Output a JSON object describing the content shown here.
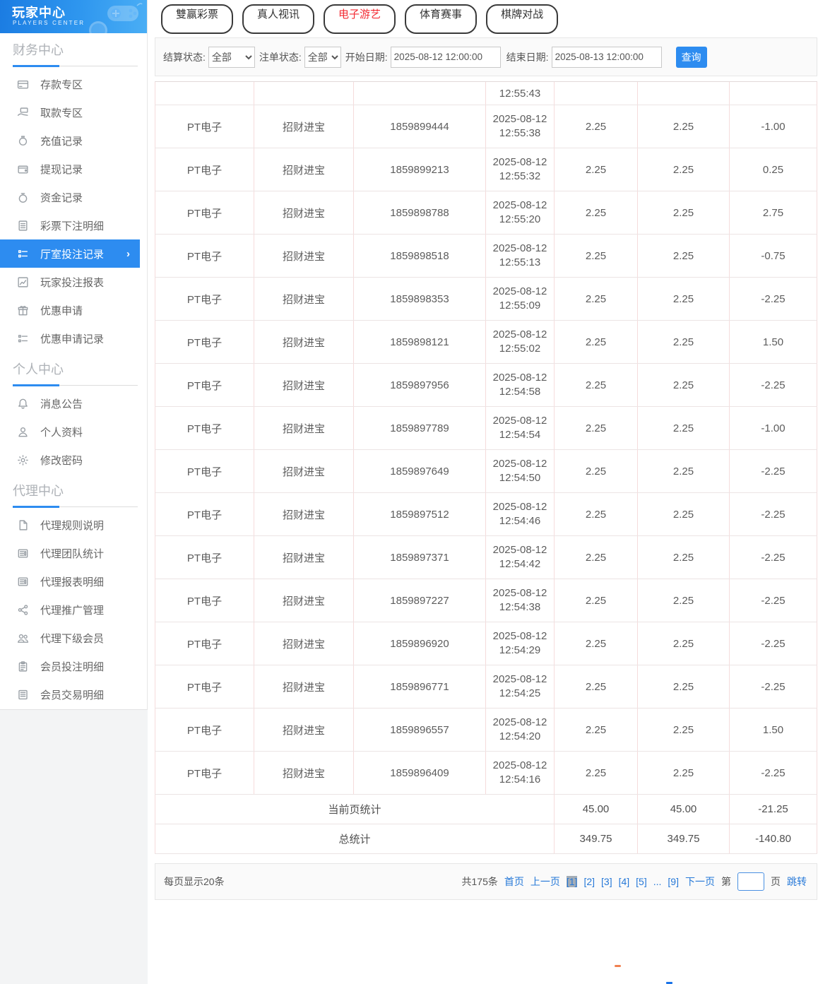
{
  "brand": {
    "title": "玩家中心",
    "subtitle": "PLAYERS CENTER"
  },
  "colors": {
    "accent_blue": "#2d8cf0",
    "link_blue": "#2779d8",
    "active_red": "#f32b33",
    "table_border_pink": "#f5dcdc",
    "current_page_bg": "#a4adb6"
  },
  "sidebar": {
    "sections": [
      {
        "title": "财务中心",
        "items": [
          {
            "label": "存款专区",
            "icon": "card"
          },
          {
            "label": "取款专区",
            "icon": "hand"
          },
          {
            "label": "充值记录",
            "icon": "moneybag"
          },
          {
            "label": "提现记录",
            "icon": "wallet"
          },
          {
            "label": "资金记录",
            "icon": "coins"
          },
          {
            "label": "彩票下注明细",
            "icon": "doc"
          },
          {
            "label": "厅室投注记录",
            "icon": "list",
            "active": true,
            "chevron": "›"
          },
          {
            "label": "玩家投注报表",
            "icon": "chart"
          },
          {
            "label": "优惠申请",
            "icon": "gift"
          },
          {
            "label": "优惠申请记录",
            "icon": "list"
          }
        ]
      },
      {
        "title": "个人中心",
        "items": [
          {
            "label": "消息公告",
            "icon": "bell"
          },
          {
            "label": "个人资料",
            "icon": "user"
          },
          {
            "label": "修改密码",
            "icon": "gear"
          }
        ]
      },
      {
        "title": "代理中心",
        "items": [
          {
            "label": "代理规则说明",
            "icon": "file"
          },
          {
            "label": "代理团队统计",
            "icon": "news"
          },
          {
            "label": "代理报表明细",
            "icon": "news"
          },
          {
            "label": "代理推广管理",
            "icon": "share"
          },
          {
            "label": "代理下级会员",
            "icon": "users"
          },
          {
            "label": "会员投注明细",
            "icon": "clipboard"
          },
          {
            "label": "会员交易明细",
            "icon": "book"
          }
        ]
      }
    ]
  },
  "tabs": [
    {
      "label": "雙赢彩票",
      "active": false
    },
    {
      "label": "真人视讯",
      "active": false
    },
    {
      "label": "电子游艺",
      "active": true
    },
    {
      "label": "体育赛事",
      "active": false
    },
    {
      "label": "棋牌对战",
      "active": false
    }
  ],
  "filters": {
    "settle_label": "结算状态:",
    "settle_value": "全部",
    "order_label": "注单状态:",
    "order_value": "全部",
    "start_label": "开始日期:",
    "start_value": "2025-08-12 12:00:00",
    "end_label": "结束日期:",
    "end_value": "2025-08-13 12:00:00",
    "query_label": "查询"
  },
  "table": {
    "partial_row_time": "12:55:43",
    "rows": [
      [
        "PT电子",
        "招财进宝",
        "1859899444",
        "2025-08-12",
        "12:55:38",
        "2.25",
        "2.25",
        "-1.00"
      ],
      [
        "PT电子",
        "招财进宝",
        "1859899213",
        "2025-08-12",
        "12:55:32",
        "2.25",
        "2.25",
        "0.25"
      ],
      [
        "PT电子",
        "招财进宝",
        "1859898788",
        "2025-08-12",
        "12:55:20",
        "2.25",
        "2.25",
        "2.75"
      ],
      [
        "PT电子",
        "招财进宝",
        "1859898518",
        "2025-08-12",
        "12:55:13",
        "2.25",
        "2.25",
        "-0.75"
      ],
      [
        "PT电子",
        "招财进宝",
        "1859898353",
        "2025-08-12",
        "12:55:09",
        "2.25",
        "2.25",
        "-2.25"
      ],
      [
        "PT电子",
        "招财进宝",
        "1859898121",
        "2025-08-12",
        "12:55:02",
        "2.25",
        "2.25",
        "1.50"
      ],
      [
        "PT电子",
        "招财进宝",
        "1859897956",
        "2025-08-12",
        "12:54:58",
        "2.25",
        "2.25",
        "-2.25"
      ],
      [
        "PT电子",
        "招财进宝",
        "1859897789",
        "2025-08-12",
        "12:54:54",
        "2.25",
        "2.25",
        "-1.00"
      ],
      [
        "PT电子",
        "招财进宝",
        "1859897649",
        "2025-08-12",
        "12:54:50",
        "2.25",
        "2.25",
        "-2.25"
      ],
      [
        "PT电子",
        "招财进宝",
        "1859897512",
        "2025-08-12",
        "12:54:46",
        "2.25",
        "2.25",
        "-2.25"
      ],
      [
        "PT电子",
        "招财进宝",
        "1859897371",
        "2025-08-12",
        "12:54:42",
        "2.25",
        "2.25",
        "-2.25"
      ],
      [
        "PT电子",
        "招财进宝",
        "1859897227",
        "2025-08-12",
        "12:54:38",
        "2.25",
        "2.25",
        "-2.25"
      ],
      [
        "PT电子",
        "招财进宝",
        "1859896920",
        "2025-08-12",
        "12:54:29",
        "2.25",
        "2.25",
        "-2.25"
      ],
      [
        "PT电子",
        "招财进宝",
        "1859896771",
        "2025-08-12",
        "12:54:25",
        "2.25",
        "2.25",
        "-2.25"
      ],
      [
        "PT电子",
        "招财进宝",
        "1859896557",
        "2025-08-12",
        "12:54:20",
        "2.25",
        "2.25",
        "1.50"
      ],
      [
        "PT电子",
        "招财进宝",
        "1859896409",
        "2025-08-12",
        "12:54:16",
        "2.25",
        "2.25",
        "-2.25"
      ]
    ],
    "page_summary": {
      "label": "当前页统计",
      "values": [
        "45.00",
        "45.00",
        "-21.25"
      ]
    },
    "total_summary": {
      "label": "总统计",
      "values": [
        "349.75",
        "349.75",
        "-140.80"
      ]
    }
  },
  "pagination": {
    "per_page": "每页显示20条",
    "total": "共175条",
    "first": "首页",
    "prev": "上一页",
    "pages": [
      {
        "label": "[1]",
        "current": true
      },
      {
        "label": "[2]"
      },
      {
        "label": "[3]"
      },
      {
        "label": "[4]"
      },
      {
        "label": "[5]"
      },
      {
        "label": "...",
        "ellipsis": true
      },
      {
        "label": "[9]"
      }
    ],
    "next": "下一页",
    "jump_pre": "第",
    "jump_post": "页",
    "jump": "跳转"
  }
}
